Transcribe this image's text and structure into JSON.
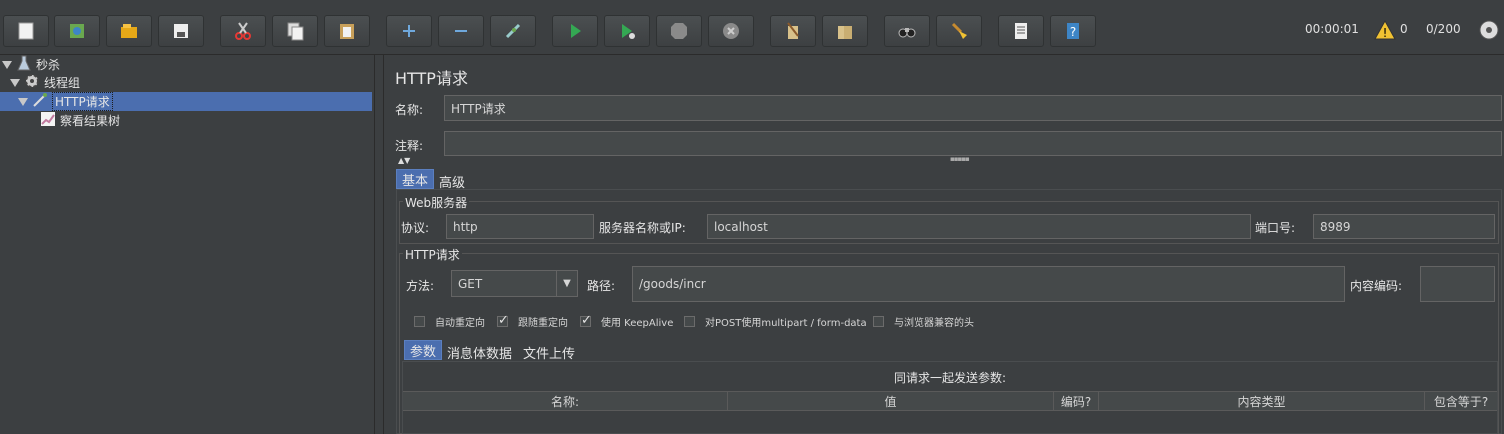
{
  "toolbar": {
    "buttons": [
      {
        "name": "new-icon"
      },
      {
        "name": "templates-icon"
      },
      {
        "name": "open-icon"
      },
      {
        "name": "save-icon"
      },
      {
        "name": "cut-icon"
      },
      {
        "name": "copy-icon"
      },
      {
        "name": "paste-icon"
      },
      {
        "name": "expand-icon"
      },
      {
        "name": "collapse-icon"
      },
      {
        "name": "toggle-icon"
      },
      {
        "name": "start-icon"
      },
      {
        "name": "start-no-pause-icon"
      },
      {
        "name": "stop-icon"
      },
      {
        "name": "shutdown-icon"
      },
      {
        "name": "clear-icon"
      },
      {
        "name": "clear-all-icon"
      },
      {
        "name": "search-icon"
      },
      {
        "name": "reset-search-icon"
      },
      {
        "name": "function-helper-icon"
      },
      {
        "name": "help-icon"
      }
    ],
    "elapsed": "00:00:01",
    "warning_count": "0",
    "threads": "0/200"
  },
  "tree": {
    "items": [
      {
        "label": "秒杀"
      },
      {
        "label": "线程组"
      },
      {
        "label": "HTTP请求"
      },
      {
        "label": "察看结果树"
      }
    ]
  },
  "panel": {
    "title": "HTTP请求",
    "name_label": "名称:",
    "name_value": "HTTP请求",
    "comment_label": "注释:",
    "comment_value": "",
    "tabs": [
      {
        "label": "基本"
      },
      {
        "label": "高级"
      }
    ],
    "web_server": {
      "group_title": "Web服务器",
      "protocol_label": "协议:",
      "protocol_value": "http",
      "server_label": "服务器名称或IP:",
      "server_value": "localhost",
      "port_label": "端口号:",
      "port_value": "8989"
    },
    "http_request": {
      "group_title": "HTTP请求",
      "method_label": "方法:",
      "method_value": "GET",
      "path_label": "路径:",
      "path_value": "/goods/incr",
      "encoding_label": "内容编码:",
      "encoding_value": ""
    },
    "checkboxes": [
      {
        "label": "自动重定向",
        "checked": false
      },
      {
        "label": "跟随重定向",
        "checked": true
      },
      {
        "label": "使用 KeepAlive",
        "checked": true
      },
      {
        "label": "对POST使用multipart / form-data",
        "checked": false
      },
      {
        "label": "与浏览器兼容的头",
        "checked": false
      }
    ],
    "sub_tabs": [
      {
        "label": "参数"
      },
      {
        "label": "消息体数据"
      },
      {
        "label": "文件上传"
      }
    ],
    "params": {
      "caption": "同请求一起发送参数:",
      "columns": [
        "名称:",
        "值",
        "编码?",
        "内容类型",
        "包含等于?"
      ]
    }
  },
  "colors": {
    "accent": "#4b6eaf",
    "background": "#3c3f41",
    "input": "#45494a"
  }
}
